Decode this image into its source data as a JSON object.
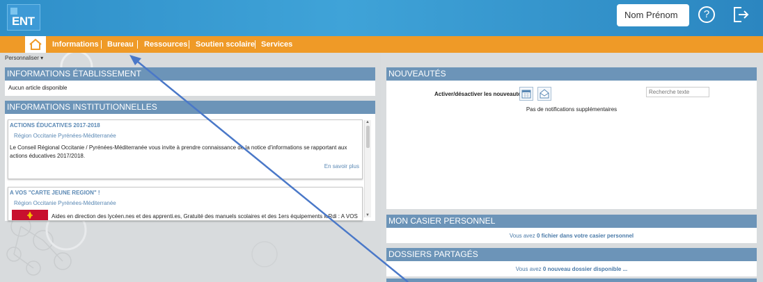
{
  "header": {
    "logo_text": "ENT",
    "user_name": "Nom Prénom",
    "help_label": "?"
  },
  "nav": {
    "items": [
      {
        "label": "Informations"
      },
      {
        "label": "Bureau"
      },
      {
        "label": "Ressources"
      },
      {
        "label": "Soutien scolaire"
      },
      {
        "label": "Services"
      }
    ]
  },
  "personnaliser": "Personnaliser ▾",
  "info_etab": {
    "title": "INFORMATIONS ÉTABLISSEMENT",
    "empty": "Aucun article disponible"
  },
  "info_inst": {
    "title": "INFORMATIONS INSTITUTIONNELLES",
    "articles": [
      {
        "title": "ACTIONS ÉDUCATIVES 2017-2018",
        "source": "Région Occitanie Pyrénées-Méditerranée",
        "text_line1": "Le Conseil Régional Occitanie / Pyrénées-Méditerranée vous invite à prendre connaissance de la notice d'informations se rapportant aux",
        "text_line2": "actions éducatives 2017/2018.",
        "link": "En savoir plus"
      },
      {
        "title": "A VOS \"CARTE JEUNE REGION\" !",
        "source": "Région Occitanie Pyrénées-Méditerranée",
        "text_line1": "Aides en direction des lycéen.nes et des apprenti.es, Gratuité des manuels scolaires et des 1ers équipements loRdi : A VOS"
      }
    ]
  },
  "nouveautes": {
    "title": "NOUVEAUTÉS",
    "toggle_label": "Activer/désactiver les nouveautés",
    "search_placeholder": "Recherche texte",
    "empty": "Pas de notifications supplémentaires"
  },
  "casier": {
    "title": "MON CASIER PERSONNEL",
    "pre": "Vous avez ",
    "bold": "0 fichier dans votre casier personnel"
  },
  "dossiers": {
    "title": "DOSSIERS PARTAGÉS",
    "pre": "Vous avez ",
    "bold": "0 nouveau dossier disponible ..."
  },
  "colors": {
    "header_blue": "#3fa3d8",
    "nav_orange": "#ef9a27",
    "panel_head": "#6c94b8",
    "link_blue": "#5a88b4",
    "arrow": "#4a78c8"
  }
}
